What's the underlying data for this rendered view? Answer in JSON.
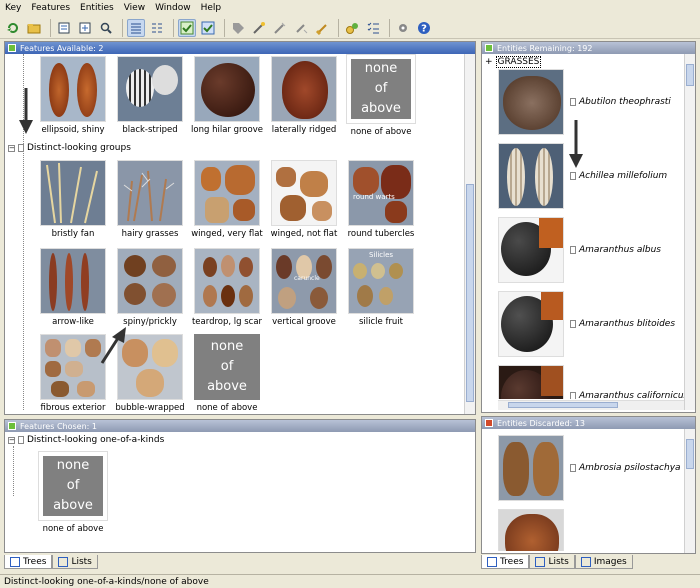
{
  "menu": [
    "Key",
    "Features",
    "Entities",
    "View",
    "Window",
    "Help"
  ],
  "toolbar": [
    "refresh-icon",
    "open-folder-icon",
    "tree-import-icon",
    "tree-export-icon",
    "find-icon",
    "list-view-icon",
    "list-detail-icon",
    "check-green-icon",
    "check-blue-icon",
    "tag-icon",
    "wand-icon",
    "wand-alt-icon",
    "wand-alt2-icon",
    "broom-icon",
    "coins-icon",
    "checklist-icon",
    "settings-icon",
    "help-icon"
  ],
  "features_available": {
    "title": "Features Available: 2",
    "top_row": [
      {
        "label": "ellipsoid, shiny"
      },
      {
        "label": "black-striped"
      },
      {
        "label": "long hilar groove"
      },
      {
        "label": "laterally ridged"
      },
      {
        "label": "none of above",
        "none_text": [
          "none",
          "of",
          "above"
        ]
      }
    ],
    "group_label": "Distinct-looking groups",
    "rows": [
      [
        {
          "label": "bristly fan"
        },
        {
          "label": "hairy grasses"
        },
        {
          "label": "winged, very flat"
        },
        {
          "label": "winged, not flat"
        },
        {
          "label": "round tubercles",
          "overlay": "round warts"
        }
      ],
      [
        {
          "label": "arrow-like"
        },
        {
          "label": "spiny/prickly"
        },
        {
          "label": "teardrop, lg scar"
        },
        {
          "label": "vertical groove",
          "overlay": "caruncle"
        },
        {
          "label": "silicle fruit",
          "overlay": "Silicles"
        }
      ],
      [
        {
          "label": "fibrous exterior"
        },
        {
          "label": "bubble-wrapped"
        },
        {
          "label": "none of above",
          "none_text": [
            "none",
            "of",
            "above"
          ]
        }
      ]
    ]
  },
  "features_chosen": {
    "title": "Features Chosen: 1",
    "group_label": "Distinct-looking one-of-a-kinds",
    "item": {
      "label": "none of above",
      "none_text": [
        "none",
        "of",
        "above"
      ]
    }
  },
  "left_tabs": [
    "Trees",
    "Lists"
  ],
  "entities_remaining": {
    "title": "Entities Remaining: 192",
    "group_label": "GRASSES",
    "items": [
      {
        "name": "Abutilon theophrasti"
      },
      {
        "name": "Achillea millefolium"
      },
      {
        "name": "Amaranthus albus"
      },
      {
        "name": "Amaranthus blitoides"
      },
      {
        "name": "Amaranthus californicus"
      }
    ]
  },
  "entities_discarded": {
    "title": "Entities Discarded: 13",
    "items": [
      {
        "name": "Ambrosia psilostachya"
      },
      {
        "name": ""
      }
    ]
  },
  "right_tabs": [
    "Trees",
    "Lists",
    "Images"
  ],
  "status": "Distinct-looking one-of-a-kinds/none of above",
  "colors": {
    "header_blue": "#4a72c0",
    "header_grey": "#9aa6bd",
    "selected_tab": "#ffffff"
  }
}
